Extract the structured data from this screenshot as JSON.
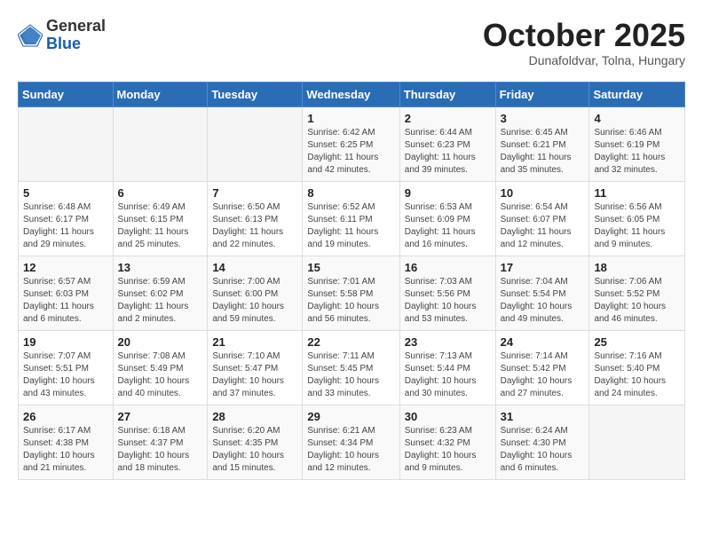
{
  "header": {
    "logo_general": "General",
    "logo_blue": "Blue",
    "title": "October 2025",
    "subtitle": "Dunafoldvar, Tolna, Hungary"
  },
  "days_of_week": [
    "Sunday",
    "Monday",
    "Tuesday",
    "Wednesday",
    "Thursday",
    "Friday",
    "Saturday"
  ],
  "weeks": [
    [
      {
        "day": "",
        "info": ""
      },
      {
        "day": "",
        "info": ""
      },
      {
        "day": "",
        "info": ""
      },
      {
        "day": "1",
        "info": "Sunrise: 6:42 AM\nSunset: 6:25 PM\nDaylight: 11 hours and 42 minutes."
      },
      {
        "day": "2",
        "info": "Sunrise: 6:44 AM\nSunset: 6:23 PM\nDaylight: 11 hours and 39 minutes."
      },
      {
        "day": "3",
        "info": "Sunrise: 6:45 AM\nSunset: 6:21 PM\nDaylight: 11 hours and 35 minutes."
      },
      {
        "day": "4",
        "info": "Sunrise: 6:46 AM\nSunset: 6:19 PM\nDaylight: 11 hours and 32 minutes."
      }
    ],
    [
      {
        "day": "5",
        "info": "Sunrise: 6:48 AM\nSunset: 6:17 PM\nDaylight: 11 hours and 29 minutes."
      },
      {
        "day": "6",
        "info": "Sunrise: 6:49 AM\nSunset: 6:15 PM\nDaylight: 11 hours and 25 minutes."
      },
      {
        "day": "7",
        "info": "Sunrise: 6:50 AM\nSunset: 6:13 PM\nDaylight: 11 hours and 22 minutes."
      },
      {
        "day": "8",
        "info": "Sunrise: 6:52 AM\nSunset: 6:11 PM\nDaylight: 11 hours and 19 minutes."
      },
      {
        "day": "9",
        "info": "Sunrise: 6:53 AM\nSunset: 6:09 PM\nDaylight: 11 hours and 16 minutes."
      },
      {
        "day": "10",
        "info": "Sunrise: 6:54 AM\nSunset: 6:07 PM\nDaylight: 11 hours and 12 minutes."
      },
      {
        "day": "11",
        "info": "Sunrise: 6:56 AM\nSunset: 6:05 PM\nDaylight: 11 hours and 9 minutes."
      }
    ],
    [
      {
        "day": "12",
        "info": "Sunrise: 6:57 AM\nSunset: 6:03 PM\nDaylight: 11 hours and 6 minutes."
      },
      {
        "day": "13",
        "info": "Sunrise: 6:59 AM\nSunset: 6:02 PM\nDaylight: 11 hours and 2 minutes."
      },
      {
        "day": "14",
        "info": "Sunrise: 7:00 AM\nSunset: 6:00 PM\nDaylight: 10 hours and 59 minutes."
      },
      {
        "day": "15",
        "info": "Sunrise: 7:01 AM\nSunset: 5:58 PM\nDaylight: 10 hours and 56 minutes."
      },
      {
        "day": "16",
        "info": "Sunrise: 7:03 AM\nSunset: 5:56 PM\nDaylight: 10 hours and 53 minutes."
      },
      {
        "day": "17",
        "info": "Sunrise: 7:04 AM\nSunset: 5:54 PM\nDaylight: 10 hours and 49 minutes."
      },
      {
        "day": "18",
        "info": "Sunrise: 7:06 AM\nSunset: 5:52 PM\nDaylight: 10 hours and 46 minutes."
      }
    ],
    [
      {
        "day": "19",
        "info": "Sunrise: 7:07 AM\nSunset: 5:51 PM\nDaylight: 10 hours and 43 minutes."
      },
      {
        "day": "20",
        "info": "Sunrise: 7:08 AM\nSunset: 5:49 PM\nDaylight: 10 hours and 40 minutes."
      },
      {
        "day": "21",
        "info": "Sunrise: 7:10 AM\nSunset: 5:47 PM\nDaylight: 10 hours and 37 minutes."
      },
      {
        "day": "22",
        "info": "Sunrise: 7:11 AM\nSunset: 5:45 PM\nDaylight: 10 hours and 33 minutes."
      },
      {
        "day": "23",
        "info": "Sunrise: 7:13 AM\nSunset: 5:44 PM\nDaylight: 10 hours and 30 minutes."
      },
      {
        "day": "24",
        "info": "Sunrise: 7:14 AM\nSunset: 5:42 PM\nDaylight: 10 hours and 27 minutes."
      },
      {
        "day": "25",
        "info": "Sunrise: 7:16 AM\nSunset: 5:40 PM\nDaylight: 10 hours and 24 minutes."
      }
    ],
    [
      {
        "day": "26",
        "info": "Sunrise: 6:17 AM\nSunset: 4:38 PM\nDaylight: 10 hours and 21 minutes."
      },
      {
        "day": "27",
        "info": "Sunrise: 6:18 AM\nSunset: 4:37 PM\nDaylight: 10 hours and 18 minutes."
      },
      {
        "day": "28",
        "info": "Sunrise: 6:20 AM\nSunset: 4:35 PM\nDaylight: 10 hours and 15 minutes."
      },
      {
        "day": "29",
        "info": "Sunrise: 6:21 AM\nSunset: 4:34 PM\nDaylight: 10 hours and 12 minutes."
      },
      {
        "day": "30",
        "info": "Sunrise: 6:23 AM\nSunset: 4:32 PM\nDaylight: 10 hours and 9 minutes."
      },
      {
        "day": "31",
        "info": "Sunrise: 6:24 AM\nSunset: 4:30 PM\nDaylight: 10 hours and 6 minutes."
      },
      {
        "day": "",
        "info": ""
      }
    ]
  ]
}
